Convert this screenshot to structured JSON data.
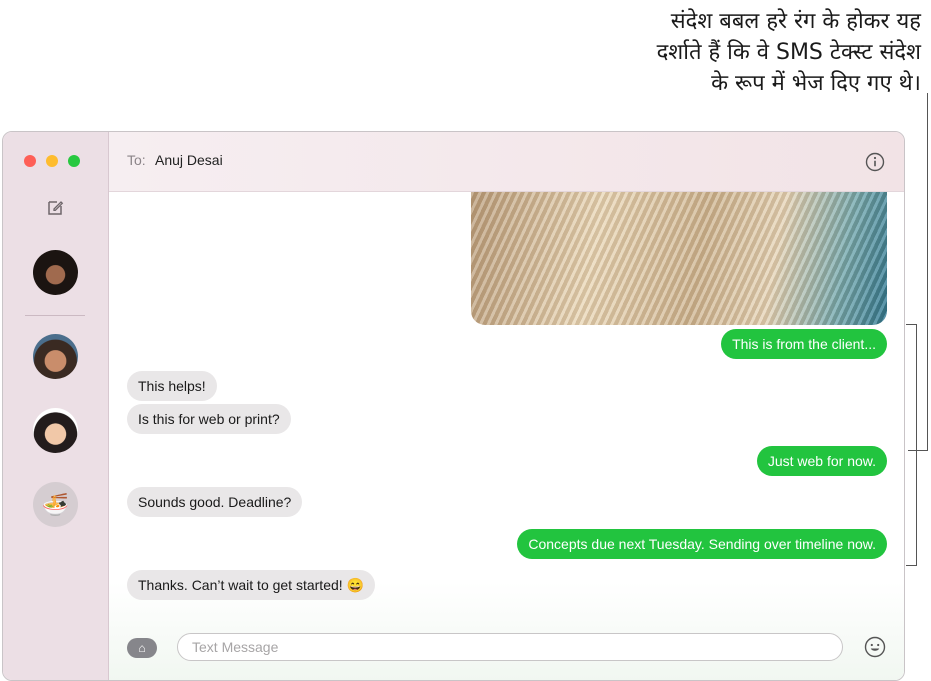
{
  "callout": {
    "lines": [
      "संदेश बबल हरे रंग के होकर यह",
      "दर्शाते हैं कि वे SMS टेक्स्ट संदेश",
      "के रूप में भेज दिए गए थे।"
    ]
  },
  "sidebar": {
    "conversations": [
      {
        "icon": "avatar-person"
      },
      {
        "icon": "avatar-person"
      },
      {
        "icon": "avatar-person"
      },
      {
        "icon": "avatar-noodles",
        "glyph": "🍜"
      }
    ]
  },
  "header": {
    "to_label": "To:",
    "recipient": "Anuj Desai"
  },
  "messages": [
    {
      "direction": "outgoing",
      "text": "This is from the client..."
    },
    {
      "direction": "incoming",
      "text": "This helps!"
    },
    {
      "direction": "incoming",
      "text": "Is this for web or print?"
    },
    {
      "direction": "outgoing",
      "text": "Just web for now."
    },
    {
      "direction": "incoming",
      "text": "Sounds good. Deadline?"
    },
    {
      "direction": "outgoing",
      "text": "Concepts due next Tuesday. Sending over timeline now."
    },
    {
      "direction": "incoming",
      "text": "Thanks. Can’t wait to get started! 😄"
    }
  ],
  "composer": {
    "placeholder": "Text Message",
    "value": ""
  },
  "colors": {
    "sms_bubble": "#22c43f",
    "incoming_bubble": "#e9e7e8",
    "sidebar": "#ecdfe5"
  }
}
